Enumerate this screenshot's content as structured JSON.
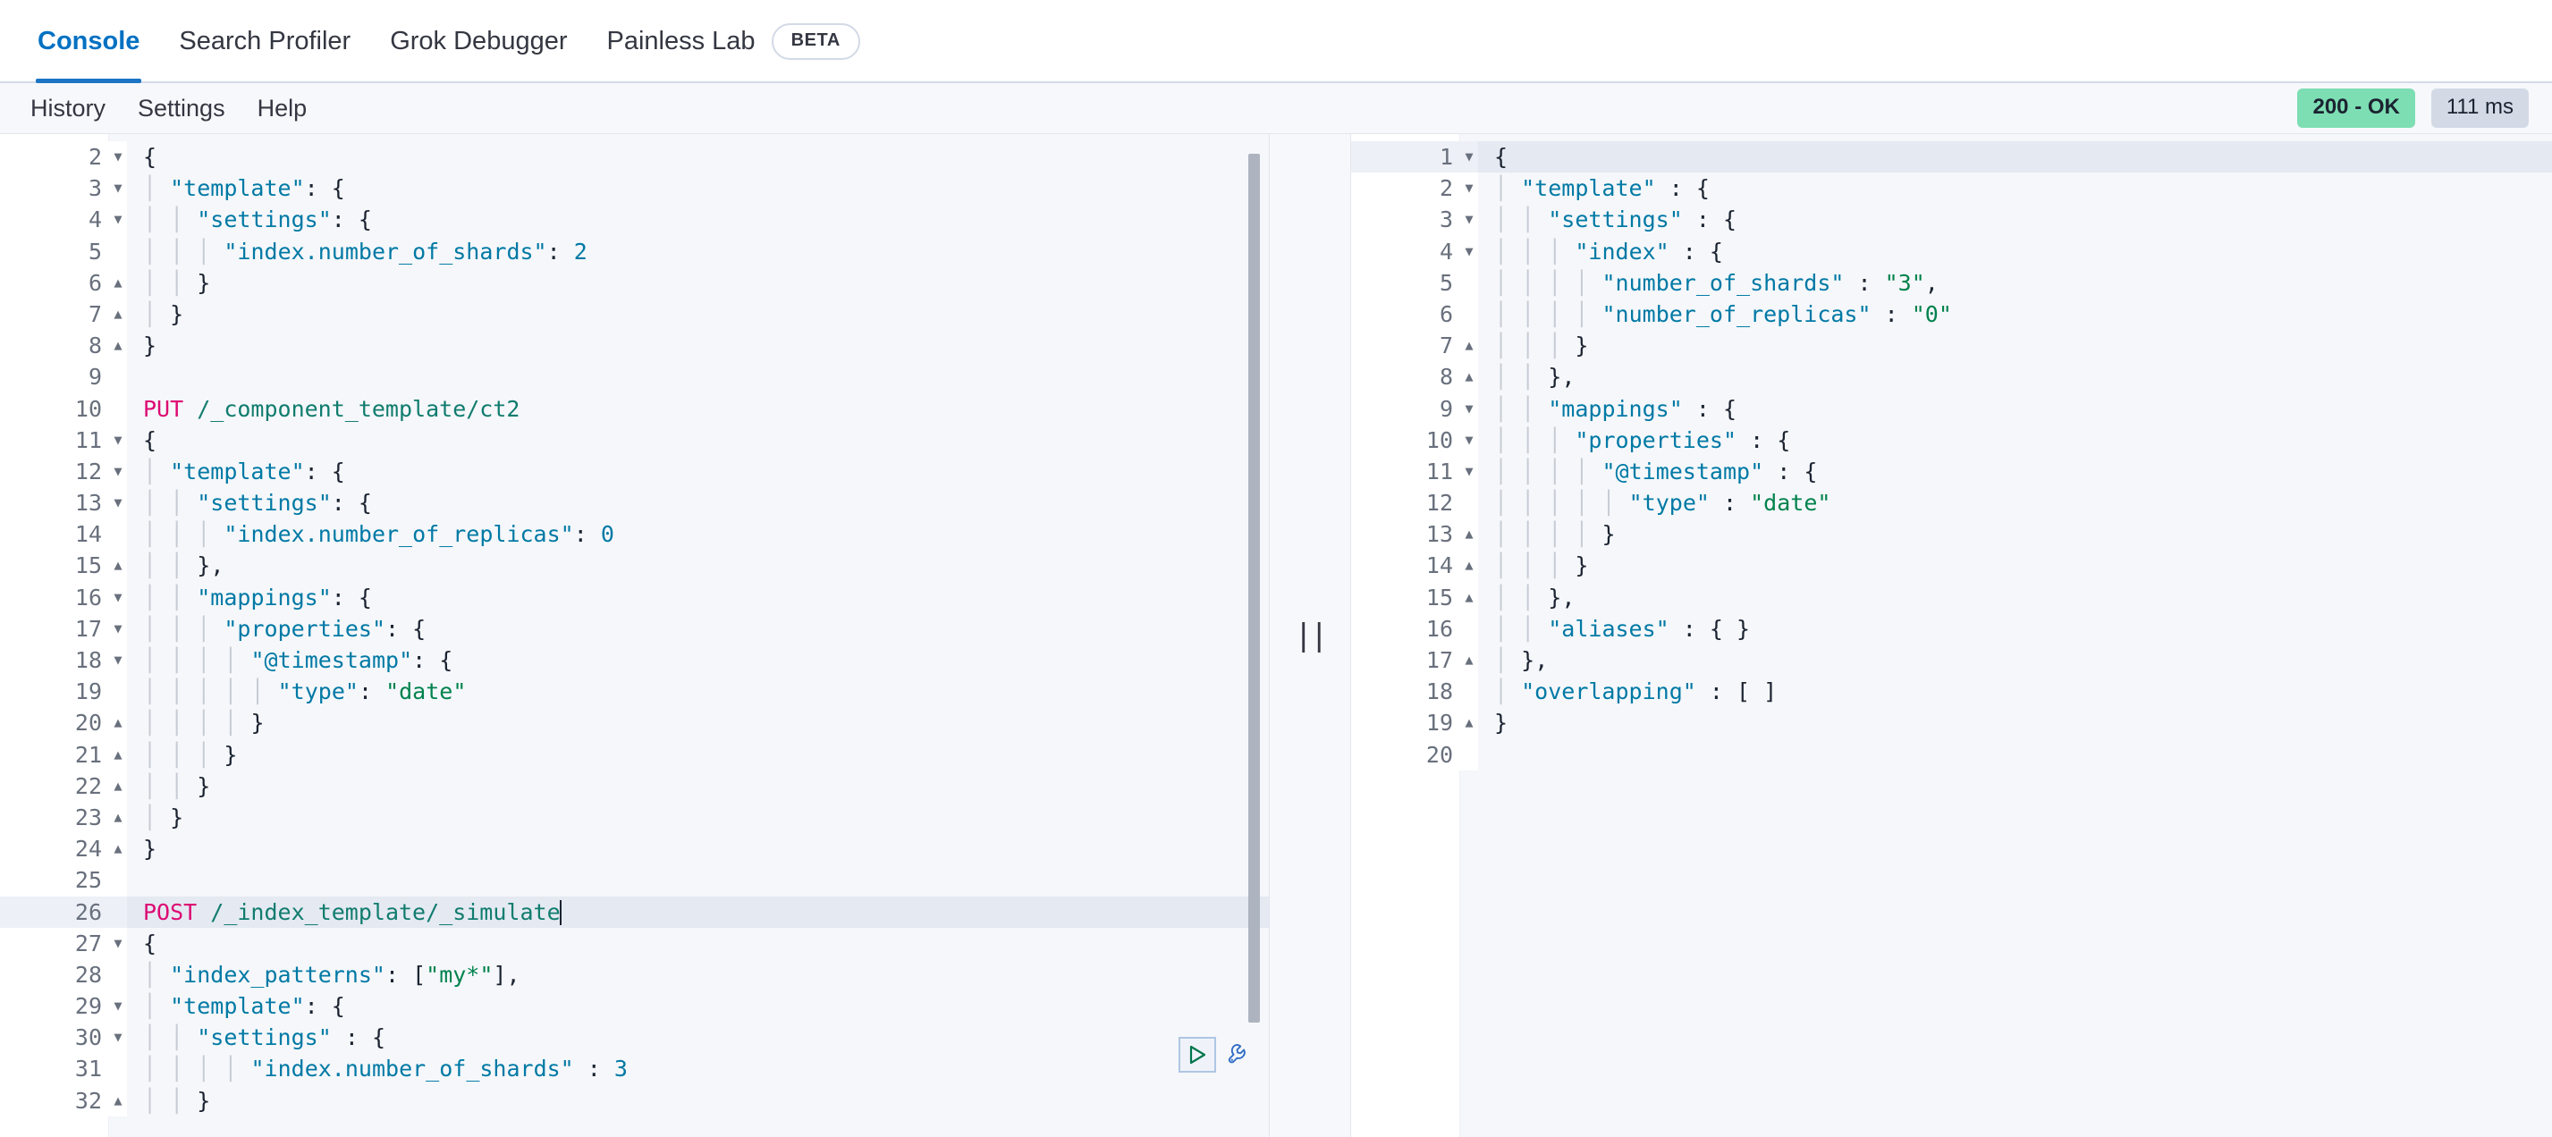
{
  "tabs": [
    {
      "label": "Console",
      "active": true
    },
    {
      "label": "Search Profiler",
      "active": false
    },
    {
      "label": "Grok Debugger",
      "active": false
    },
    {
      "label": "Painless Lab",
      "active": false,
      "badge": "BETA"
    }
  ],
  "subbar": {
    "items": [
      {
        "label": "History"
      },
      {
        "label": "Settings"
      },
      {
        "label": "Help"
      }
    ],
    "status": "200 - OK",
    "duration": "111 ms",
    "status_color": "#7DDEB3",
    "duration_color": "#D3DAE6"
  },
  "colors": {
    "accent": "#1B74C4",
    "method": "#DD0A73",
    "url": "#107C6E",
    "key": "#0079A5",
    "string": "#00824D",
    "highlight": "#E4E9F2",
    "play": "#00754B",
    "wrench": "#2E6BC6"
  },
  "editor": {
    "scroll_thumb_label": "editor-vertical-scrollbar",
    "cursor_line": 26,
    "lines": [
      {
        "n": 2,
        "fold": "down",
        "text": "{",
        "tokens": [
          {
            "t": "{",
            "c": "p"
          }
        ]
      },
      {
        "n": 3,
        "fold": "down",
        "text": "  \"template\": {"
      },
      {
        "n": 4,
        "fold": "down",
        "text": "    \"settings\": {"
      },
      {
        "n": 5,
        "fold": "",
        "text": "      \"index.number_of_shards\": 2"
      },
      {
        "n": 6,
        "fold": "up",
        "text": "    }"
      },
      {
        "n": 7,
        "fold": "up",
        "text": "  }"
      },
      {
        "n": 8,
        "fold": "up",
        "text": "}"
      },
      {
        "n": 9,
        "fold": "",
        "text": ""
      },
      {
        "n": 10,
        "fold": "",
        "text": "PUT /_component_template/ct2"
      },
      {
        "n": 11,
        "fold": "down",
        "text": "{"
      },
      {
        "n": 12,
        "fold": "down",
        "text": "  \"template\": {"
      },
      {
        "n": 13,
        "fold": "down",
        "text": "    \"settings\": {"
      },
      {
        "n": 14,
        "fold": "",
        "text": "      \"index.number_of_replicas\": 0"
      },
      {
        "n": 15,
        "fold": "up",
        "text": "    },"
      },
      {
        "n": 16,
        "fold": "down",
        "text": "    \"mappings\": {"
      },
      {
        "n": 17,
        "fold": "down",
        "text": "      \"properties\": {"
      },
      {
        "n": 18,
        "fold": "down",
        "text": "        \"@timestamp\": {"
      },
      {
        "n": 19,
        "fold": "",
        "text": "          \"type\": \"date\""
      },
      {
        "n": 20,
        "fold": "up",
        "text": "        }"
      },
      {
        "n": 21,
        "fold": "up",
        "text": "      }"
      },
      {
        "n": 22,
        "fold": "up",
        "text": "    }"
      },
      {
        "n": 23,
        "fold": "up",
        "text": "  }"
      },
      {
        "n": 24,
        "fold": "up",
        "text": "}"
      },
      {
        "n": 25,
        "fold": "",
        "text": ""
      },
      {
        "n": 26,
        "fold": "",
        "text": "POST /_index_template/_simulate"
      },
      {
        "n": 27,
        "fold": "down",
        "text": "{"
      },
      {
        "n": 28,
        "fold": "",
        "text": "  \"index_patterns\": [\"my*\"],"
      },
      {
        "n": 29,
        "fold": "down",
        "text": "  \"template\": {"
      },
      {
        "n": 30,
        "fold": "down",
        "text": "    \"settings\" : {"
      },
      {
        "n": 31,
        "fold": "",
        "text": "        \"index.number_of_shards\" : 3"
      },
      {
        "n": 32,
        "fold": "up",
        "text": "    }"
      }
    ]
  },
  "response": {
    "lines": [
      {
        "n": 1,
        "fold": "down",
        "text": "{"
      },
      {
        "n": 2,
        "fold": "down",
        "text": "  \"template\" : {"
      },
      {
        "n": 3,
        "fold": "down",
        "text": "    \"settings\" : {"
      },
      {
        "n": 4,
        "fold": "down",
        "text": "      \"index\" : {"
      },
      {
        "n": 5,
        "fold": "",
        "text": "        \"number_of_shards\" : \"3\","
      },
      {
        "n": 6,
        "fold": "",
        "text": "        \"number_of_replicas\" : \"0\""
      },
      {
        "n": 7,
        "fold": "up",
        "text": "      }"
      },
      {
        "n": 8,
        "fold": "up",
        "text": "    },"
      },
      {
        "n": 9,
        "fold": "down",
        "text": "    \"mappings\" : {"
      },
      {
        "n": 10,
        "fold": "down",
        "text": "      \"properties\" : {"
      },
      {
        "n": 11,
        "fold": "down",
        "text": "        \"@timestamp\" : {"
      },
      {
        "n": 12,
        "fold": "",
        "text": "          \"type\" : \"date\""
      },
      {
        "n": 13,
        "fold": "up",
        "text": "        }"
      },
      {
        "n": 14,
        "fold": "up",
        "text": "      }"
      },
      {
        "n": 15,
        "fold": "up",
        "text": "    },"
      },
      {
        "n": 16,
        "fold": "",
        "text": "    \"aliases\" : { }"
      },
      {
        "n": 17,
        "fold": "up",
        "text": "  },"
      },
      {
        "n": 18,
        "fold": "",
        "text": "  \"overlapping\" : [ ]"
      },
      {
        "n": 19,
        "fold": "up",
        "text": "}"
      },
      {
        "n": 20,
        "fold": "",
        "text": ""
      }
    ]
  },
  "actions": {
    "play_label": "send-request",
    "wrench_label": "request-options"
  },
  "splitter": {
    "grip": "||"
  }
}
